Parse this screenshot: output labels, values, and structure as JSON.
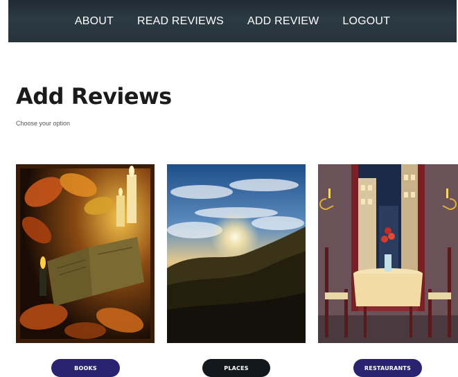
{
  "nav": {
    "items": [
      {
        "label": "ABOUT"
      },
      {
        "label": "READ REVIEWS"
      },
      {
        "label": "ADD REVIEW"
      },
      {
        "label": "LOGOUT"
      }
    ]
  },
  "header": {
    "title": "Add Reviews",
    "subtitle": "Choose your option"
  },
  "options": [
    {
      "label": "BOOKS",
      "image": "autumn-book-candle-photo",
      "color": "#2a2470"
    },
    {
      "label": "PLACES",
      "image": "mountain-sunset-photo",
      "color": "#12181c"
    },
    {
      "label": "RESTAURANTS",
      "image": "restaurant-table-illustration",
      "color": "#2a2470"
    }
  ]
}
